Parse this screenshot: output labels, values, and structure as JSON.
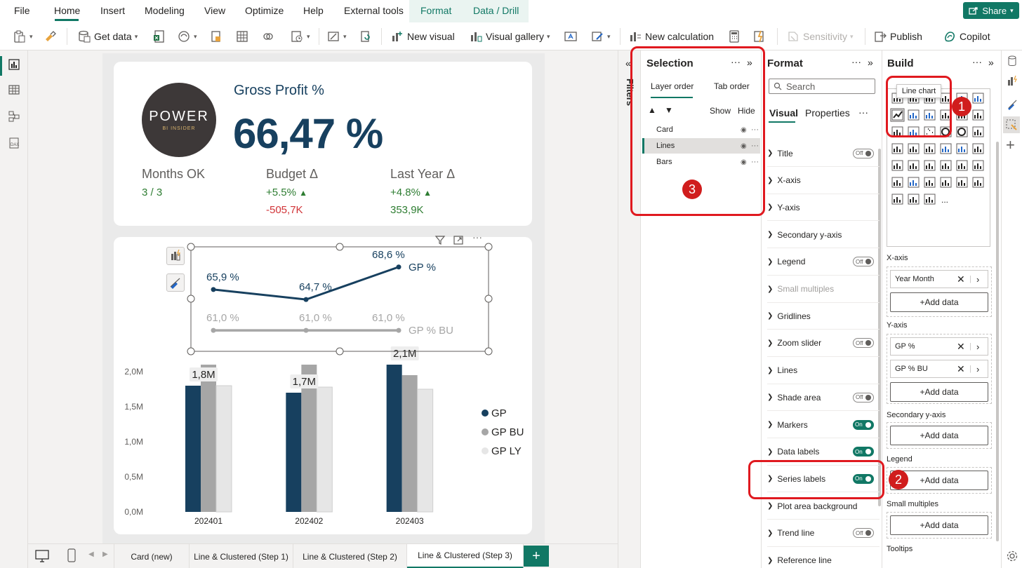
{
  "menu": {
    "items": [
      "File",
      "Home",
      "Insert",
      "Modeling",
      "View",
      "Optimize",
      "Help",
      "External tools"
    ],
    "contextual": [
      "Format",
      "Data / Drill"
    ],
    "share": "Share"
  },
  "ribbon": {
    "get_data": "Get data",
    "new_visual": "New visual",
    "visual_gallery": "Visual gallery",
    "new_calculation": "New calculation",
    "sensitivity": "Sensitivity",
    "publish": "Publish",
    "copilot": "Copilot"
  },
  "kpi_card": {
    "logo_text": "POWER",
    "logo_sub": "BI INSIDER",
    "title": "Gross Profit %",
    "value": "66,47 %",
    "months_label": "Months OK",
    "months_value": "3 / 3",
    "budget_label": "Budget Δ",
    "budget_pct": "+5.5%",
    "budget_abs": "-505,7K",
    "ly_label": "Last Year Δ",
    "ly_pct": "+4.8%",
    "ly_abs": "353,9K"
  },
  "chart_data": {
    "type": "bar",
    "categories": [
      "202401",
      "202402",
      "202403"
    ],
    "series": [
      {
        "name": "GP",
        "values": [
          1.8,
          1.7,
          2.1
        ],
        "color": "#17405f"
      },
      {
        "name": "GP BU",
        "values": [
          2.1,
          2.1,
          1.95
        ],
        "color": "#a6a6a6"
      },
      {
        "name": "GP LY",
        "values": [
          1.8,
          1.78,
          1.75
        ],
        "color": "#e6e6e6"
      }
    ],
    "bar_labels": [
      "1,8M",
      "1,7M",
      "2,1M"
    ],
    "yticks": [
      "0,0M",
      "0,5M",
      "1,0M",
      "1,5M",
      "2,0M"
    ],
    "ylim": [
      0,
      2.2
    ],
    "legend_position": "right",
    "lines": [
      {
        "name": "GP %",
        "values": [
          65.9,
          64.7,
          68.6
        ],
        "labels": [
          "65,9 %",
          "64,7 %",
          "68,6 %"
        ],
        "color": "#17405f"
      },
      {
        "name": "GP % BU",
        "values": [
          61.0,
          61.0,
          61.0
        ],
        "labels": [
          "61,0 %",
          "61,0 %",
          "61,0 %"
        ],
        "color": "#a6a6a6"
      }
    ]
  },
  "sheet_tabs": [
    "Card (new)",
    "Line & Clustered (Step 1)",
    "Line & Clustered (Step 2)",
    "Line & Clustered (Step 3)"
  ],
  "active_tab": "Line & Clustered (Step 3)",
  "filters_label": "Filters",
  "selection": {
    "title": "Selection",
    "tabs": [
      "Layer order",
      "Tab order"
    ],
    "show": "Show",
    "hide": "Hide",
    "items": [
      "Card",
      "Lines",
      "Bars"
    ]
  },
  "format": {
    "title": "Format",
    "search_placeholder": "Search",
    "tabs": [
      "Visual",
      "Properties"
    ],
    "rows": [
      {
        "label": "Title",
        "toggle": "Off"
      },
      {
        "label": "X-axis",
        "toggle": ""
      },
      {
        "label": "Y-axis",
        "toggle": ""
      },
      {
        "label": "Secondary y-axis",
        "toggle": ""
      },
      {
        "label": "Legend",
        "toggle": "Off"
      },
      {
        "label": "Small multiples",
        "toggle": ""
      },
      {
        "label": "Gridlines",
        "toggle": ""
      },
      {
        "label": "Zoom slider",
        "toggle": "Off"
      },
      {
        "label": "Lines",
        "toggle": ""
      },
      {
        "label": "Shade area",
        "toggle": "Off"
      },
      {
        "label": "Markers",
        "toggle": "On"
      },
      {
        "label": "Data labels",
        "toggle": "On"
      },
      {
        "label": "Series labels",
        "toggle": "On"
      },
      {
        "label": "Plot area background",
        "toggle": ""
      },
      {
        "label": "Trend line",
        "toggle": "Off"
      },
      {
        "label": "Reference line",
        "toggle": ""
      }
    ]
  },
  "build": {
    "title": "Build",
    "tooltip": "Line chart",
    "x_axis_label": "X-axis",
    "x_field": "Year Month",
    "y_axis_label": "Y-axis",
    "y_fields": [
      "GP %",
      "GP % BU"
    ],
    "secondary_label": "Secondary y-axis",
    "legend_label": "Legend",
    "small_multiples_label": "Small multiples",
    "tooltips_label": "Tooltips",
    "add_data": "+Add data",
    "more": "..."
  },
  "annotations": [
    "1",
    "2",
    "3"
  ],
  "colors": {
    "accent": "#117865",
    "navy": "#17405f",
    "positive": "#2e7d32",
    "negative": "#d13438",
    "annotation": "#e0191f"
  }
}
